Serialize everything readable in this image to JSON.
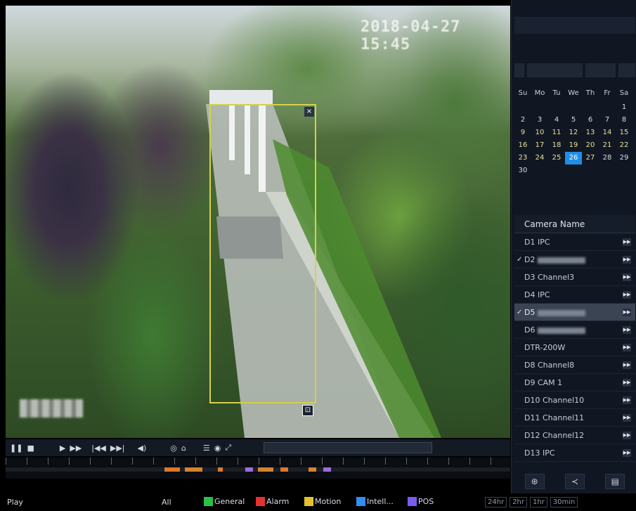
{
  "video": {
    "osd_time": "2018-04-27 15:45",
    "close_glyph": "×",
    "handle_glyph": "⊡"
  },
  "controls": {
    "pause": "❚❚",
    "stop": "■",
    "play_back": "▶",
    "fast": "▶▶",
    "prev_frame": "|◀◀",
    "next_frame": "▶▶|",
    "volume": "◀)",
    "snapshot": "◎",
    "camera": "⌂",
    "list": "☰",
    "tag": "◉",
    "fullscreen": "⤢"
  },
  "timeline": {
    "segments": [
      {
        "start": 0.315,
        "end": 0.345,
        "color": "#e0782a"
      },
      {
        "start": 0.355,
        "end": 0.39,
        "color": "#d7832e"
      },
      {
        "start": 0.42,
        "end": 0.43,
        "color": "#e0782a"
      },
      {
        "start": 0.475,
        "end": 0.49,
        "color": "#9b6ee0"
      },
      {
        "start": 0.5,
        "end": 0.53,
        "color": "#d7832e"
      },
      {
        "start": 0.545,
        "end": 0.56,
        "color": "#e0782a"
      },
      {
        "start": 0.6,
        "end": 0.615,
        "color": "#d7832e"
      },
      {
        "start": 0.63,
        "end": 0.645,
        "color": "#9b6ee0"
      }
    ]
  },
  "legend": {
    "mode": "Play",
    "all": "All",
    "items": [
      {
        "label": "General",
        "color": "#28c24b"
      },
      {
        "label": "Alarm",
        "color": "#e53131"
      },
      {
        "label": "Motion",
        "color": "#e6c12f"
      },
      {
        "label": "Intell...",
        "color": "#2f8ef0"
      },
      {
        "label": "POS",
        "color": "#7a5cf0"
      }
    ],
    "zoom": [
      "24hr",
      "2hr",
      "1hr",
      "30min"
    ]
  },
  "calendar": {
    "weekdays": [
      "Su",
      "Mo",
      "Tu",
      "We",
      "Th",
      "Fr",
      "Sa"
    ],
    "weeks": [
      [
        "",
        "",
        "",
        "",
        "",
        "",
        "1"
      ],
      [
        "2",
        "3",
        "4",
        "5",
        "6",
        "7",
        "8"
      ],
      [
        "9",
        "10",
        "11",
        "12",
        "13",
        "14",
        "15"
      ],
      [
        "16",
        "17",
        "18",
        "19",
        "20",
        "21",
        "22"
      ],
      [
        "23",
        "24",
        "25",
        "26",
        "27",
        "28",
        "29"
      ],
      [
        "30",
        "",
        "",
        "",
        "",
        "",
        ""
      ]
    ],
    "selected": "26"
  },
  "cameras": {
    "header": "Camera Name",
    "items": [
      {
        "label": "D1 IPC",
        "checked": false,
        "blurred": false,
        "selected": false
      },
      {
        "label": "D2",
        "checked": true,
        "blurred": true,
        "selected": false
      },
      {
        "label": "D3 Channel3",
        "checked": false,
        "blurred": false,
        "selected": false
      },
      {
        "label": "D4 IPC",
        "checked": false,
        "blurred": false,
        "selected": false
      },
      {
        "label": "D5",
        "checked": true,
        "blurred": true,
        "selected": true
      },
      {
        "label": "D6",
        "checked": false,
        "blurred": true,
        "selected": false
      },
      {
        "label": "DTR-200W",
        "checked": false,
        "blurred": false,
        "selected": false
      },
      {
        "label": "D8 Channel8",
        "checked": false,
        "blurred": false,
        "selected": false
      },
      {
        "label": "D9 CAM 1",
        "checked": false,
        "blurred": false,
        "selected": false
      },
      {
        "label": "D10 Channel10",
        "checked": false,
        "blurred": false,
        "selected": false
      },
      {
        "label": "D11 Channel11",
        "checked": false,
        "blurred": false,
        "selected": false
      },
      {
        "label": "D12 Channel12",
        "checked": false,
        "blurred": false,
        "selected": false
      },
      {
        "label": "D13 IPC",
        "checked": false,
        "blurred": false,
        "selected": false
      }
    ],
    "check_glyph": "✓",
    "button_glyph": "▶▶"
  },
  "panel_bottom": [
    "⊛",
    "≺",
    "▤"
  ]
}
